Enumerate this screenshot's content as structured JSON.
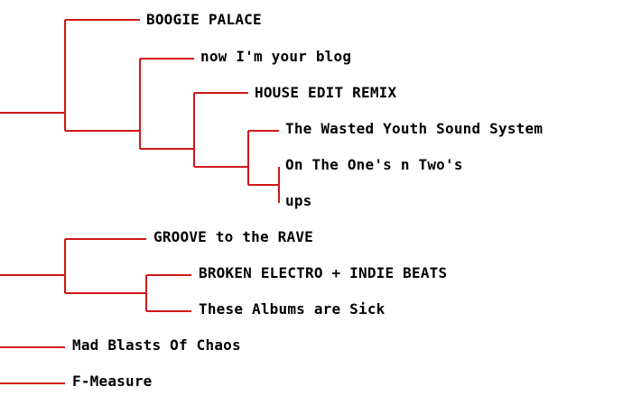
{
  "link_color": "#d01818",
  "text_color": "#000000",
  "tree": {
    "n1": {
      "label": "BOOGIE PALACE"
    },
    "n2": {
      "label": "now I'm your blog"
    },
    "n3": {
      "label": "HOUSE EDIT REMIX"
    },
    "n4": {
      "label": "The Wasted Youth Sound System"
    },
    "n5": {
      "label": "On The One's n Two's"
    },
    "n6": {
      "label": "ups"
    },
    "n7": {
      "label": "GROOVE to the RAVE"
    },
    "n8": {
      "label": "BROKEN ELECTRO + INDIE BEATS"
    },
    "n9": {
      "label": "These Albums are Sick"
    },
    "n10": {
      "label": "Mad Blasts Of Chaos"
    },
    "n11": {
      "label": "F-Measure"
    }
  }
}
